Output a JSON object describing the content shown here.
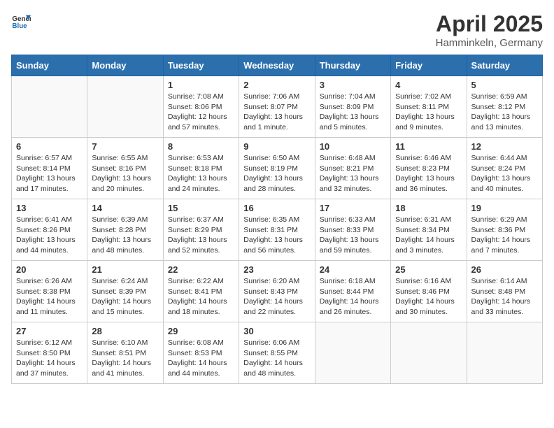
{
  "logo": {
    "text_general": "General",
    "text_blue": "Blue"
  },
  "title": "April 2025",
  "location": "Hamminkeln, Germany",
  "days_of_week": [
    "Sunday",
    "Monday",
    "Tuesday",
    "Wednesday",
    "Thursday",
    "Friday",
    "Saturday"
  ],
  "weeks": [
    [
      {
        "day": null
      },
      {
        "day": null
      },
      {
        "day": 1,
        "sunrise": "Sunrise: 7:08 AM",
        "sunset": "Sunset: 8:06 PM",
        "daylight": "Daylight: 12 hours and 57 minutes."
      },
      {
        "day": 2,
        "sunrise": "Sunrise: 7:06 AM",
        "sunset": "Sunset: 8:07 PM",
        "daylight": "Daylight: 13 hours and 1 minute."
      },
      {
        "day": 3,
        "sunrise": "Sunrise: 7:04 AM",
        "sunset": "Sunset: 8:09 PM",
        "daylight": "Daylight: 13 hours and 5 minutes."
      },
      {
        "day": 4,
        "sunrise": "Sunrise: 7:02 AM",
        "sunset": "Sunset: 8:11 PM",
        "daylight": "Daylight: 13 hours and 9 minutes."
      },
      {
        "day": 5,
        "sunrise": "Sunrise: 6:59 AM",
        "sunset": "Sunset: 8:12 PM",
        "daylight": "Daylight: 13 hours and 13 minutes."
      }
    ],
    [
      {
        "day": 6,
        "sunrise": "Sunrise: 6:57 AM",
        "sunset": "Sunset: 8:14 PM",
        "daylight": "Daylight: 13 hours and 17 minutes."
      },
      {
        "day": 7,
        "sunrise": "Sunrise: 6:55 AM",
        "sunset": "Sunset: 8:16 PM",
        "daylight": "Daylight: 13 hours and 20 minutes."
      },
      {
        "day": 8,
        "sunrise": "Sunrise: 6:53 AM",
        "sunset": "Sunset: 8:18 PM",
        "daylight": "Daylight: 13 hours and 24 minutes."
      },
      {
        "day": 9,
        "sunrise": "Sunrise: 6:50 AM",
        "sunset": "Sunset: 8:19 PM",
        "daylight": "Daylight: 13 hours and 28 minutes."
      },
      {
        "day": 10,
        "sunrise": "Sunrise: 6:48 AM",
        "sunset": "Sunset: 8:21 PM",
        "daylight": "Daylight: 13 hours and 32 minutes."
      },
      {
        "day": 11,
        "sunrise": "Sunrise: 6:46 AM",
        "sunset": "Sunset: 8:23 PM",
        "daylight": "Daylight: 13 hours and 36 minutes."
      },
      {
        "day": 12,
        "sunrise": "Sunrise: 6:44 AM",
        "sunset": "Sunset: 8:24 PM",
        "daylight": "Daylight: 13 hours and 40 minutes."
      }
    ],
    [
      {
        "day": 13,
        "sunrise": "Sunrise: 6:41 AM",
        "sunset": "Sunset: 8:26 PM",
        "daylight": "Daylight: 13 hours and 44 minutes."
      },
      {
        "day": 14,
        "sunrise": "Sunrise: 6:39 AM",
        "sunset": "Sunset: 8:28 PM",
        "daylight": "Daylight: 13 hours and 48 minutes."
      },
      {
        "day": 15,
        "sunrise": "Sunrise: 6:37 AM",
        "sunset": "Sunset: 8:29 PM",
        "daylight": "Daylight: 13 hours and 52 minutes."
      },
      {
        "day": 16,
        "sunrise": "Sunrise: 6:35 AM",
        "sunset": "Sunset: 8:31 PM",
        "daylight": "Daylight: 13 hours and 56 minutes."
      },
      {
        "day": 17,
        "sunrise": "Sunrise: 6:33 AM",
        "sunset": "Sunset: 8:33 PM",
        "daylight": "Daylight: 13 hours and 59 minutes."
      },
      {
        "day": 18,
        "sunrise": "Sunrise: 6:31 AM",
        "sunset": "Sunset: 8:34 PM",
        "daylight": "Daylight: 14 hours and 3 minutes."
      },
      {
        "day": 19,
        "sunrise": "Sunrise: 6:29 AM",
        "sunset": "Sunset: 8:36 PM",
        "daylight": "Daylight: 14 hours and 7 minutes."
      }
    ],
    [
      {
        "day": 20,
        "sunrise": "Sunrise: 6:26 AM",
        "sunset": "Sunset: 8:38 PM",
        "daylight": "Daylight: 14 hours and 11 minutes."
      },
      {
        "day": 21,
        "sunrise": "Sunrise: 6:24 AM",
        "sunset": "Sunset: 8:39 PM",
        "daylight": "Daylight: 14 hours and 15 minutes."
      },
      {
        "day": 22,
        "sunrise": "Sunrise: 6:22 AM",
        "sunset": "Sunset: 8:41 PM",
        "daylight": "Daylight: 14 hours and 18 minutes."
      },
      {
        "day": 23,
        "sunrise": "Sunrise: 6:20 AM",
        "sunset": "Sunset: 8:43 PM",
        "daylight": "Daylight: 14 hours and 22 minutes."
      },
      {
        "day": 24,
        "sunrise": "Sunrise: 6:18 AM",
        "sunset": "Sunset: 8:44 PM",
        "daylight": "Daylight: 14 hours and 26 minutes."
      },
      {
        "day": 25,
        "sunrise": "Sunrise: 6:16 AM",
        "sunset": "Sunset: 8:46 PM",
        "daylight": "Daylight: 14 hours and 30 minutes."
      },
      {
        "day": 26,
        "sunrise": "Sunrise: 6:14 AM",
        "sunset": "Sunset: 8:48 PM",
        "daylight": "Daylight: 14 hours and 33 minutes."
      }
    ],
    [
      {
        "day": 27,
        "sunrise": "Sunrise: 6:12 AM",
        "sunset": "Sunset: 8:50 PM",
        "daylight": "Daylight: 14 hours and 37 minutes."
      },
      {
        "day": 28,
        "sunrise": "Sunrise: 6:10 AM",
        "sunset": "Sunset: 8:51 PM",
        "daylight": "Daylight: 14 hours and 41 minutes."
      },
      {
        "day": 29,
        "sunrise": "Sunrise: 6:08 AM",
        "sunset": "Sunset: 8:53 PM",
        "daylight": "Daylight: 14 hours and 44 minutes."
      },
      {
        "day": 30,
        "sunrise": "Sunrise: 6:06 AM",
        "sunset": "Sunset: 8:55 PM",
        "daylight": "Daylight: 14 hours and 48 minutes."
      },
      {
        "day": null
      },
      {
        "day": null
      },
      {
        "day": null
      }
    ]
  ]
}
